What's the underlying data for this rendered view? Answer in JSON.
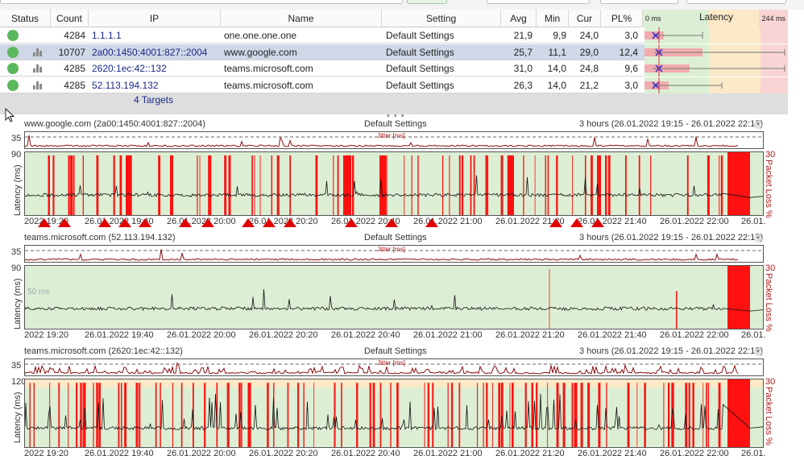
{
  "table": {
    "headers": {
      "status": "Status",
      "count": "Count",
      "ip": "IP",
      "name": "Name",
      "setting": "Setting",
      "avg": "Avg",
      "min": "Min",
      "cur": "Cur",
      "pl": "PL%",
      "latency": "Latency",
      "lat_min": "0 ms",
      "lat_max": "244 ms"
    },
    "rows": [
      {
        "count": "4284",
        "ip": "1.1.1.1",
        "name": "one.one.one.one",
        "setting": "Default Settings",
        "avg": "21,9",
        "min": "9,9",
        "cur": "24,0",
        "pl": "3,0",
        "selected": false,
        "icon": "none"
      },
      {
        "count": "10707",
        "ip": "2a00:1450:4001:827::2004",
        "name": "www.google.com",
        "setting": "Default Settings",
        "avg": "25,7",
        "min": "11,1",
        "cur": "29,0",
        "pl": "12,4",
        "selected": true,
        "icon": "bar-chart-icon"
      },
      {
        "count": "4285",
        "ip": "2620:1ec:42::132",
        "name": "teams.microsoft.com",
        "setting": "Default Settings",
        "avg": "31,0",
        "min": "14,0",
        "cur": "24,8",
        "pl": "9,6",
        "selected": false,
        "icon": "bar-chart-icon"
      },
      {
        "count": "4285",
        "ip": "52.113.194.132",
        "name": "teams.microsoft.com",
        "setting": "Default Settings",
        "avg": "26,3",
        "min": "14,0",
        "cur": "21,2",
        "pl": "3,0",
        "selected": false,
        "icon": "bar-chart-icon"
      }
    ],
    "status_color": "#5cb85c",
    "targets_label": "4 Targets"
  },
  "graphs": [
    {
      "host": "www.google.com (2a00:1450:4001:827::2004)",
      "setting": "Default Settings",
      "range": "3 hours (26.01.2022 19:15 - 26.01.2022 22:15)",
      "jitter_label": "Jitter [ms]",
      "jitter_max": "35",
      "y_max": "90",
      "y_label": "Latency (ms)",
      "pl_max": "30",
      "pl_label": "Packet Loss %",
      "x_labels": [
        "2022 19:20",
        "26.01.2022 19:40",
        "26.01.2022 20:00",
        "26.01.2022 20:20",
        "26.01.2022 20:40",
        "26.01.2022 21:00",
        "26.01.2022 21:20",
        "26.01.2022 21:40",
        "26.01.2022 22:00",
        "26.01."
      ],
      "baseline_note": "",
      "loss_level": "high"
    },
    {
      "host": "teams.microsoft.com (52.113.194.132)",
      "setting": "Default Settings",
      "range": "3 hours (26.01.2022 19:15 - 26.01.2022 22:15)",
      "jitter_label": "Jitter [ms]",
      "jitter_max": "35",
      "y_max": "90",
      "y_label": "Latency (ms)",
      "pl_max": "30",
      "pl_label": "Packet Loss %",
      "x_labels": [
        "2022 19:20",
        "26.01.2022 19:40",
        "26.01.2022 20:00",
        "26.01.2022 20:20",
        "26.01.2022 20:40",
        "26.01.2022 21:00",
        "26.01.2022 21:20",
        "26.01.2022 21:40",
        "26.01.2022 22:00",
        "26.01."
      ],
      "baseline_note": "50 ms",
      "loss_level": "low"
    },
    {
      "host": "teams.microsoft.com (2620:1ec:42::132)",
      "setting": "Default Settings",
      "range": "3 hours (26.01.2022 19:15 - 26.01.2022 22:15)",
      "jitter_label": "Jitter [ms]",
      "jitter_max": "35",
      "y_max": "120",
      "y_label": "Latency (ms)",
      "pl_max": "30",
      "pl_label": "Packet Loss %",
      "x_labels": [
        "2022 19:20",
        "26.01.2022 19:40",
        "26.01.2022 20:00",
        "26.01.2022 20:20",
        "26.01.2022 20:40",
        "26.01.2022 21:00",
        "26.01.2022 21:20",
        "26.01.2022 21:40",
        "26.01.2022 22:00",
        "26.01."
      ],
      "baseline_note": "",
      "loss_level": "high"
    }
  ],
  "colors": {
    "good": "#dcefd4",
    "warn": "#fbe9c8",
    "bad": "#f9d4d4",
    "loss": "#ff1111",
    "latency_line": "#111111",
    "jitter": "#8b1010"
  }
}
